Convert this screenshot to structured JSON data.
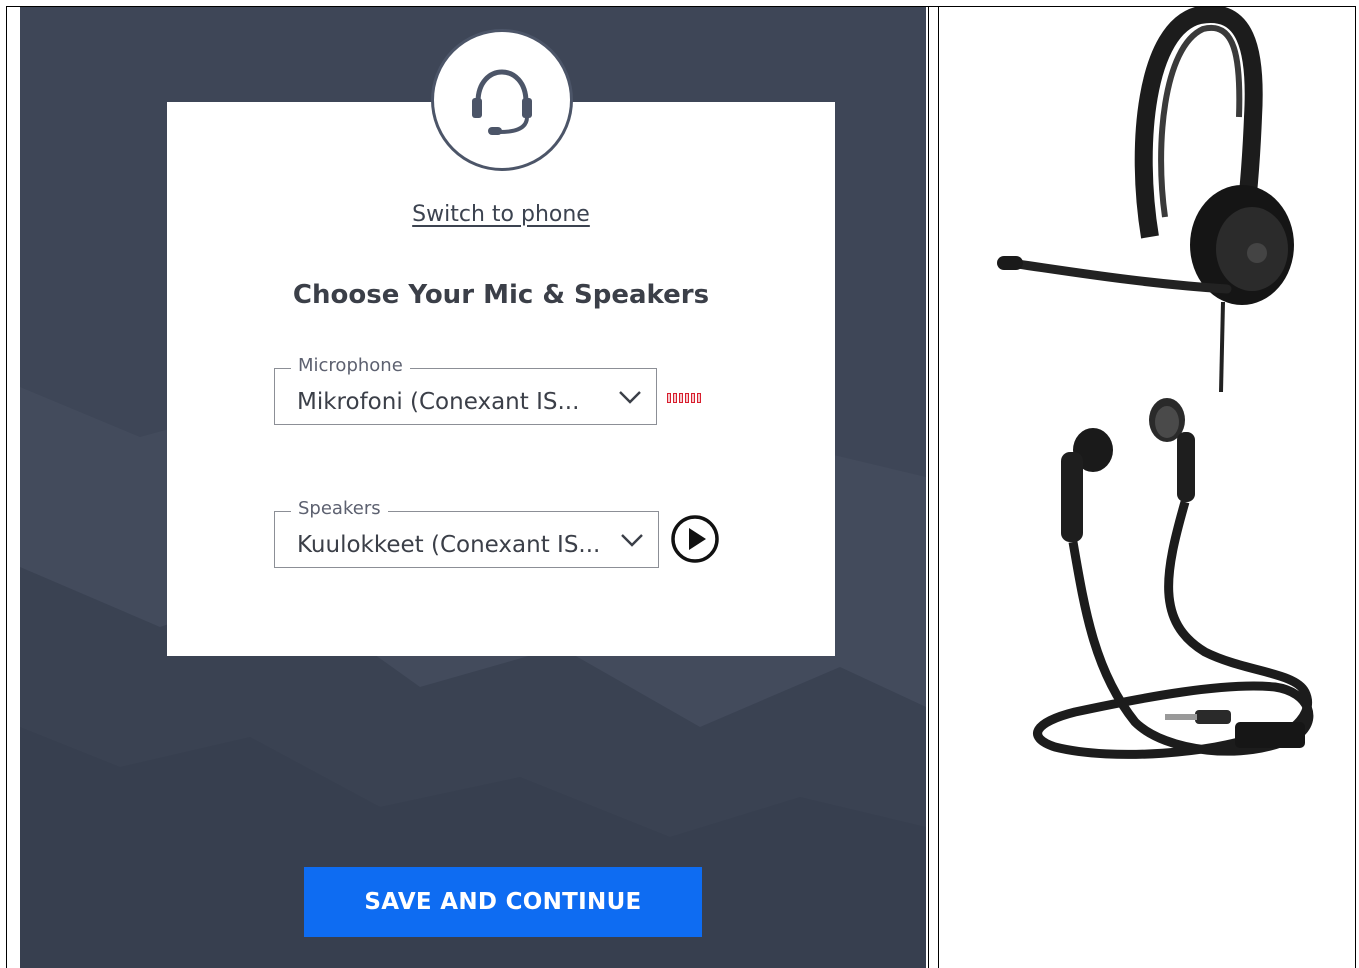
{
  "dialog": {
    "switch_link": "Switch to phone",
    "heading": "Choose Your Mic & Speakers",
    "microphone": {
      "label": "Microphone",
      "value": "Mikrofoni (Conexant IS..."
    },
    "speakers": {
      "label": "Speakers",
      "value": "Kuulokkeet (Conexant IS..."
    },
    "save_button": "SAVE AND CONTINUE"
  },
  "colors": {
    "background": "#3e4657",
    "card": "#ffffff",
    "primary_button": "#0e6cf2",
    "level_meter": "#d81e2e"
  },
  "icons": {
    "avatar": "headset-icon",
    "dropdown": "chevron-down-icon",
    "play": "play-circle-icon"
  }
}
